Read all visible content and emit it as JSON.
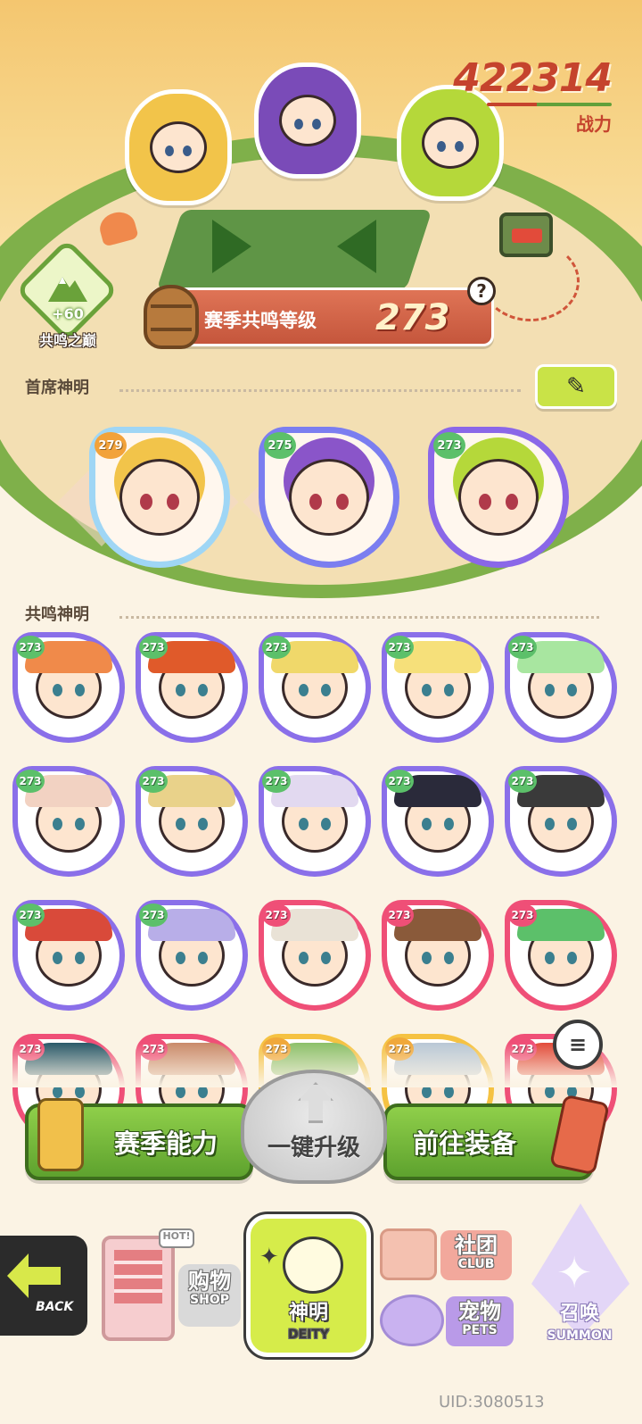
{
  "header": {
    "power_value": "422314",
    "power_label": "战力"
  },
  "resonance": {
    "peak_bonus": "+60",
    "peak_label": "共鸣之巅",
    "season_level_label": "赛季共鸣等级",
    "season_level_value": "273",
    "help_icon": "question-icon"
  },
  "chief_section": {
    "title": "首席神明",
    "edit_icon": "pencil-icon",
    "deities": [
      {
        "level": "279",
        "ring_color": "#9fd6f5",
        "accent": "#f2c44a"
      },
      {
        "level": "275",
        "ring_color": "#7b7ef0",
        "accent": "#8a55c9"
      },
      {
        "level": "273",
        "ring_color": "#8a67e8",
        "accent": "#b5d83a"
      }
    ]
  },
  "resonance_section": {
    "title": "共鸣神明",
    "deities": [
      {
        "level": "273",
        "ring_color": "#8a6fe9",
        "hair": "#f08a4a"
      },
      {
        "level": "273",
        "ring_color": "#8a6fe9",
        "hair": "#e05a2a"
      },
      {
        "level": "273",
        "ring_color": "#8a6fe9",
        "hair": "#f0d86a"
      },
      {
        "level": "273",
        "ring_color": "#8a6fe9",
        "hair": "#f6e07a"
      },
      {
        "level": "273",
        "ring_color": "#8a6fe9",
        "hair": "#a8e6a0"
      },
      {
        "level": "273",
        "ring_color": "#8a6fe9",
        "hair": "#f2d2c2"
      },
      {
        "level": "273",
        "ring_color": "#8a6fe9",
        "hair": "#e9d28a"
      },
      {
        "level": "273",
        "ring_color": "#8a6fe9",
        "hair": "#e2d9f0"
      },
      {
        "level": "273",
        "ring_color": "#8a6fe9",
        "hair": "#2a2a3a"
      },
      {
        "level": "273",
        "ring_color": "#8a6fe9",
        "hair": "#3a3a3a"
      },
      {
        "level": "273",
        "ring_color": "#8a6fe9",
        "hair": "#d94a3a"
      },
      {
        "level": "273",
        "ring_color": "#8a6fe9",
        "hair": "#b8aee8"
      },
      {
        "level": "273",
        "ring_color": "#ef4f77",
        "hair": "#e9e2d6"
      },
      {
        "level": "273",
        "ring_color": "#ef4f77",
        "hair": "#8a5a3a"
      },
      {
        "level": "273",
        "ring_color": "#ef4f77",
        "hair": "#5cc06a"
      },
      {
        "level": "273",
        "ring_color": "#ef4f77",
        "hair": "#2a5a6a"
      },
      {
        "level": "273",
        "ring_color": "#ef4f77",
        "hair": "#c98a6a"
      },
      {
        "level": "273",
        "ring_color": "#f5c242",
        "hair": "#8cc06a"
      },
      {
        "level": "273",
        "ring_color": "#f5c242",
        "hair": "#b9c8d6"
      },
      {
        "level": "273",
        "ring_color": "#ef4f77",
        "hair": "#e24b3a"
      }
    ],
    "filter_icon": "filter-icon"
  },
  "actions": {
    "season_ability": "赛季能力",
    "one_click_upgrade": "一键升级",
    "go_equip": "前往装备"
  },
  "bottom_nav": {
    "back": "BACK",
    "shop_cn": "购物",
    "shop_en": "SHOP",
    "shop_tag": "HOT!",
    "deity_cn": "神明",
    "deity_en": "DEITY",
    "club_cn": "社团",
    "club_en": "CLUB",
    "pets_cn": "宠物",
    "pets_en": "PETS",
    "summon_cn": "召唤",
    "summon_en": "SUMMON"
  },
  "footer": {
    "uid": "UID:3080513"
  }
}
